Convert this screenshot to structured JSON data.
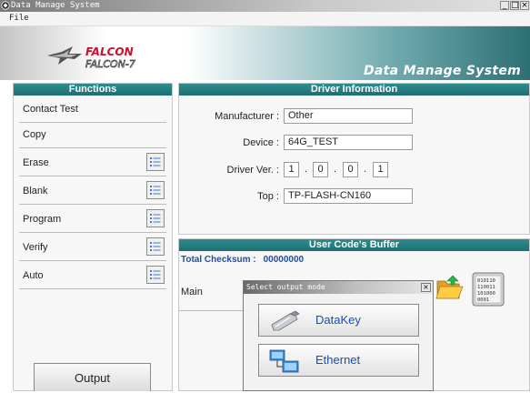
{
  "window": {
    "title": "Data Manage System",
    "buttons": [
      "_",
      "□",
      "×"
    ]
  },
  "menu": {
    "file": "File"
  },
  "banner": {
    "logo_top": "FALCON",
    "logo_bottom": "FALCON-7",
    "title": "Data Manage System"
  },
  "functions": {
    "header": "Functions",
    "items": [
      {
        "label": "Contact Test",
        "has_list": false
      },
      {
        "label": "Copy",
        "has_list": false
      },
      {
        "label": "Erase",
        "has_list": true
      },
      {
        "label": "Blank",
        "has_list": true
      },
      {
        "label": "Program",
        "has_list": true
      },
      {
        "label": "Verify",
        "has_list": true
      },
      {
        "label": "Auto",
        "has_list": true
      }
    ],
    "output_button": "Output"
  },
  "driver": {
    "header": "Driver Information",
    "manufacturer_label": "Manufacturer :",
    "manufacturer": "Other",
    "device_label": "Device :",
    "device": "64G_TEST",
    "version_label": "Driver Ver. :",
    "version": [
      "1",
      "0",
      "0",
      "1"
    ],
    "top_label": "Top :",
    "top": "TP-FLASH-CN160"
  },
  "buffer": {
    "header": "User Code's Buffer",
    "checksum_label": "Total Checksum :",
    "checksum": "00000000",
    "main_label": "Main",
    "binary_lines": [
      "010110",
      "110011",
      "101000",
      "0001"
    ]
  },
  "dialog": {
    "title": "Select output mode",
    "close": "×",
    "options": [
      {
        "label": "DataKey",
        "icon": "usb-key-icon"
      },
      {
        "label": "Ethernet",
        "icon": "network-computers-icon"
      }
    ]
  },
  "colors": {
    "header_teal": "#1d6f72",
    "checksum_blue": "#1f4fa0",
    "dialog_link_blue": "#1a4fa8",
    "logo_red": "#c8102e"
  }
}
